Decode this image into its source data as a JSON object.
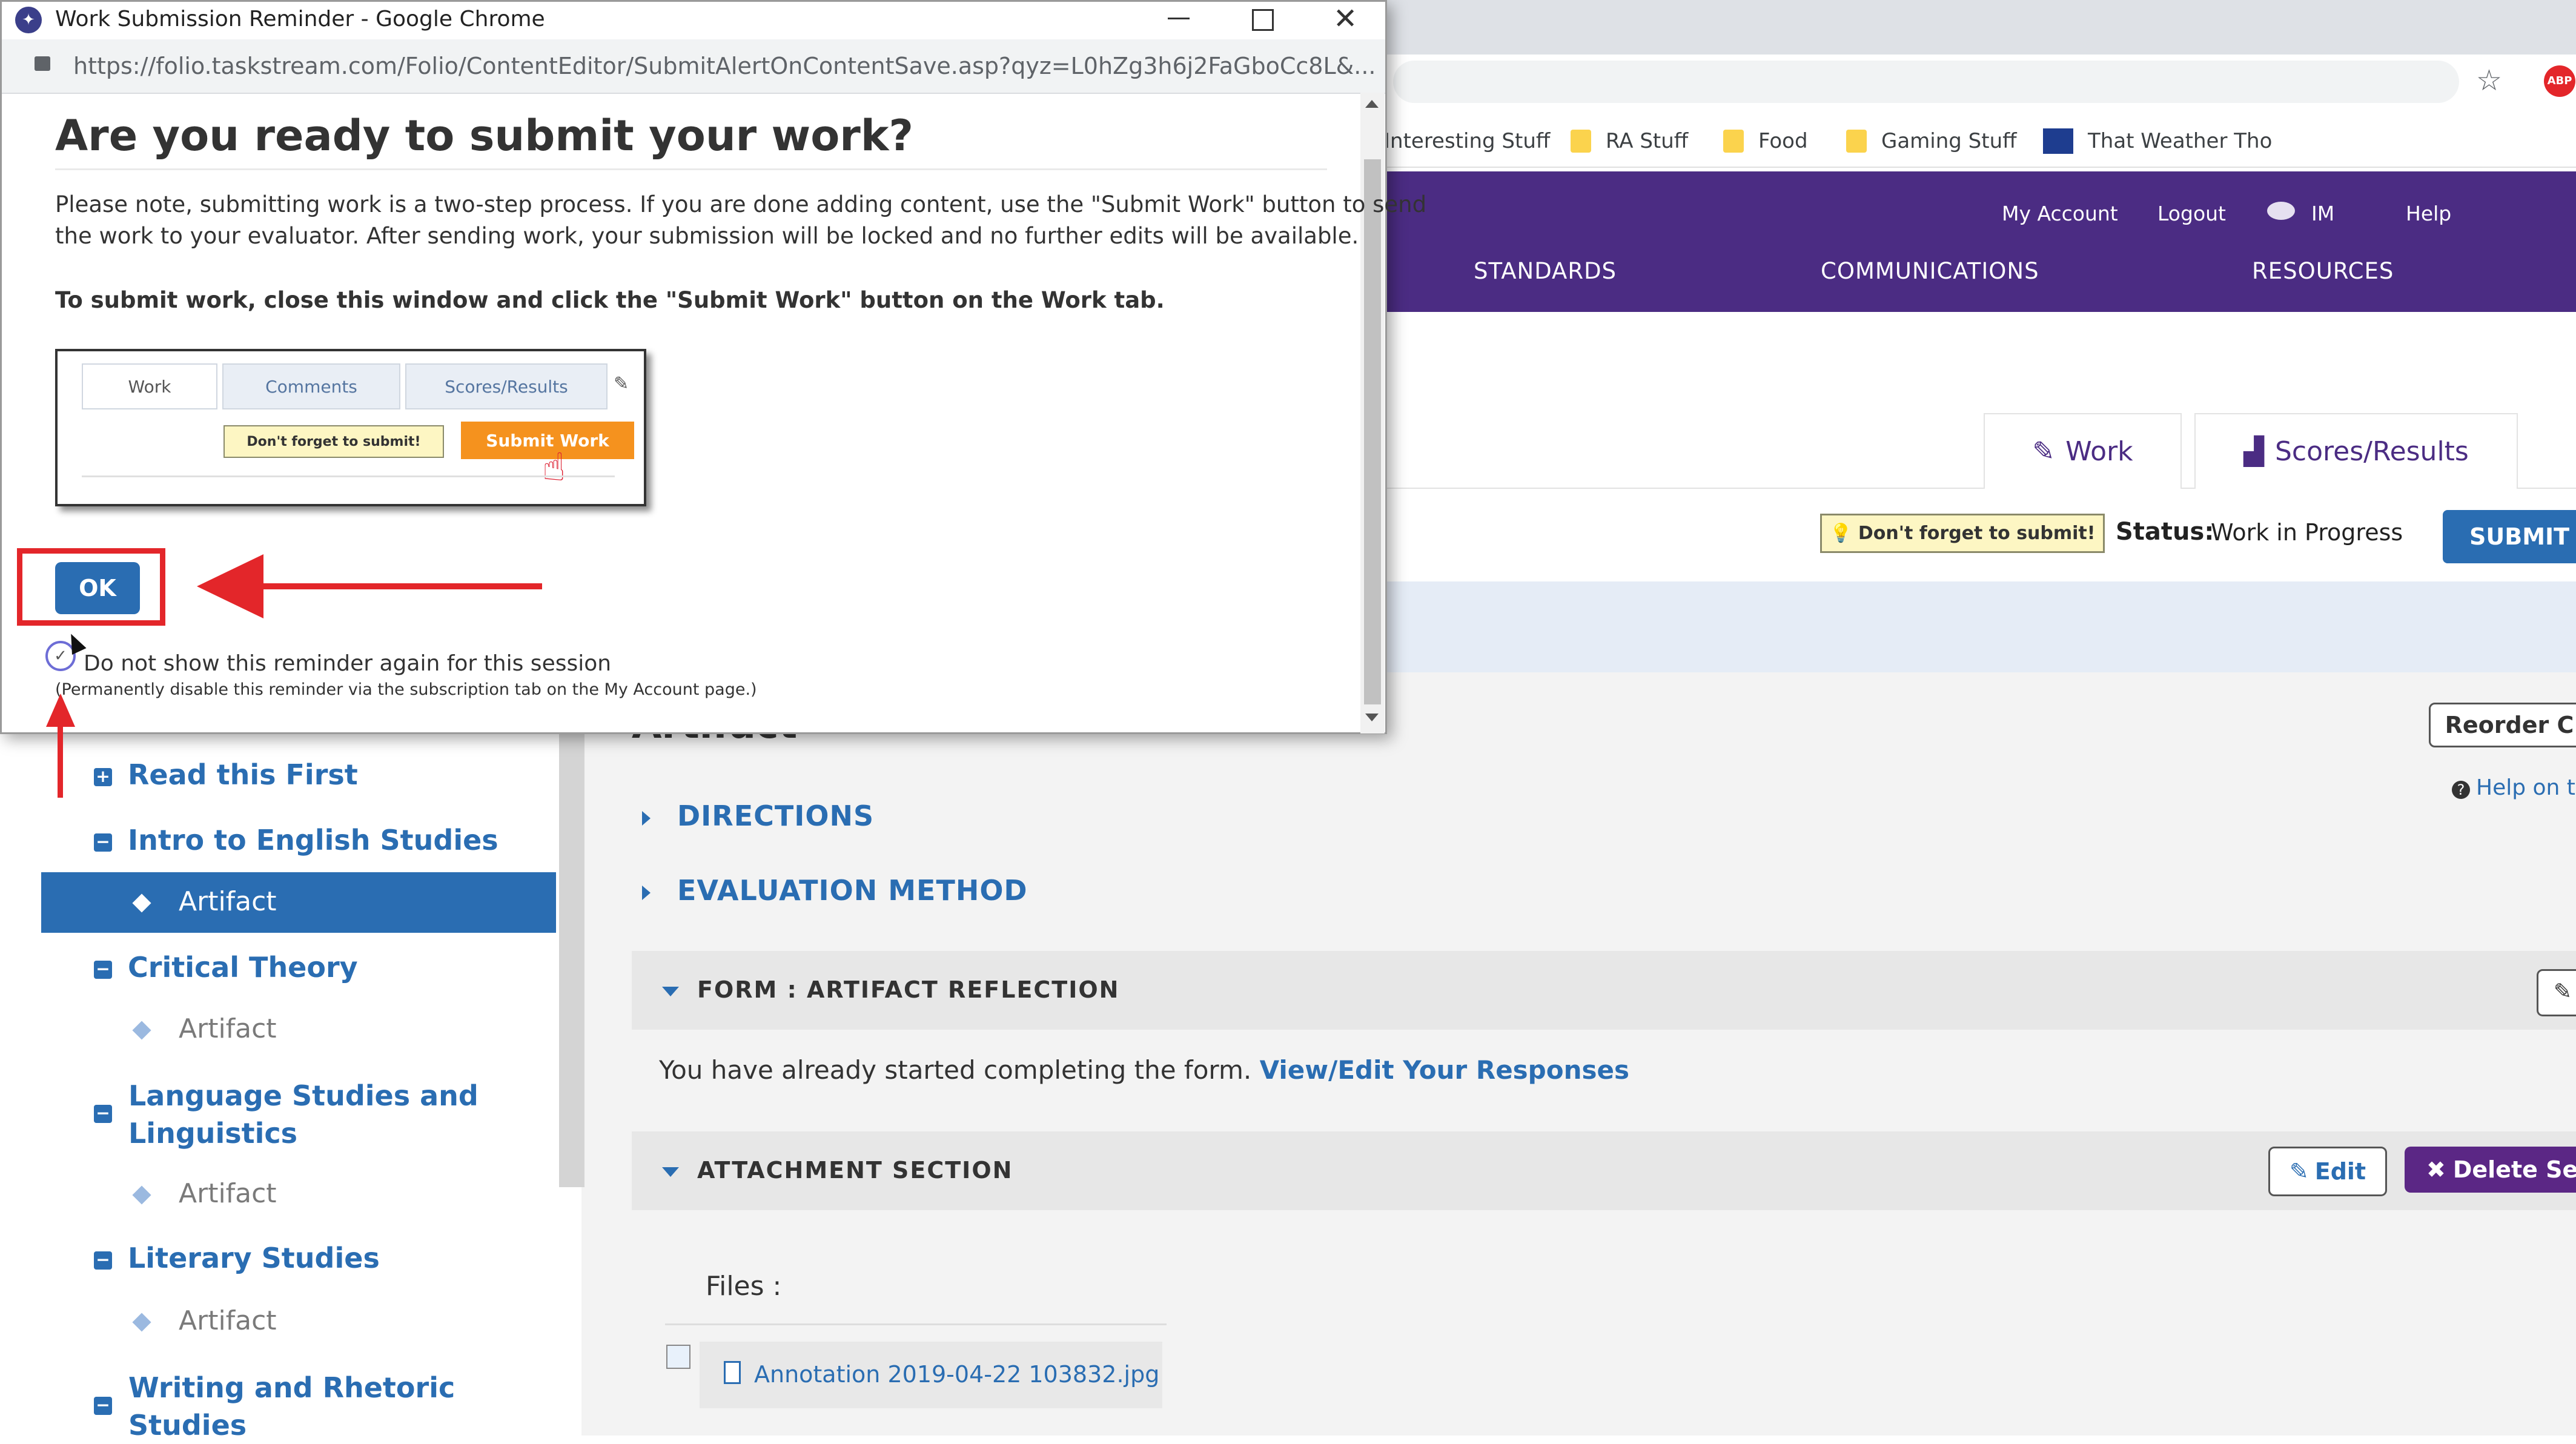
{
  "popup": {
    "window_title": "Work Submission Reminder - Google Chrome",
    "url": "https://folio.taskstream.com/Folio/ContentEditor/SubmitAlertOnContentSave.asp?qyz=L0hZg3h6j2FaGboCc8L&...",
    "heading": "Are you ready to submit your work?",
    "paragraph_line1": "Please note, submitting work is a two-step process. If you are done adding content, use the \"Submit Work\" button to send",
    "paragraph_line2": "the work to your evaluator. After sending work, your submission will be locked and no further edits will be available.",
    "instruction": "To submit work, close this window and click the \"Submit Work\" button on the Work tab.",
    "mini_tabs": [
      "Work",
      "Comments",
      "Scores/Results"
    ],
    "mini_reminder": "Don't forget to submit!",
    "mini_submit": "Submit Work",
    "ok_label": "OK",
    "checkbox_label": "Do not show this reminder again for this session",
    "checkbox_note": "(Permanently disable this reminder via the subscription tab on the My Account page.)"
  },
  "bookmarks": [
    "Interesting Stuff",
    "RA Stuff",
    "Food",
    "Gaming Stuff",
    "That Weather Tho"
  ],
  "header": {
    "top_links": [
      "My Account",
      "Logout",
      "IM",
      "Help"
    ],
    "nav": [
      "STANDARDS",
      "COMMUNICATIONS",
      "RESOURCES"
    ]
  },
  "work_tabs": [
    "Work",
    "Scores/Results"
  ],
  "status": {
    "reminder": "Don't forget to submit!",
    "label": "Status:",
    "value": "Work in Progress",
    "submit": "SUBMIT"
  },
  "reorder_button": "Reorder C",
  "help_link": "Help on t",
  "artifact_heading": "Artifact",
  "sidebar": [
    {
      "label": "Read this First",
      "icon": "plus"
    },
    {
      "label": "Intro to English Studies",
      "icon": "minus"
    },
    {
      "label": "Artifact",
      "sub": true,
      "active": true
    },
    {
      "label": "Critical Theory",
      "icon": "minus"
    },
    {
      "label": "Artifact",
      "sub": true
    },
    {
      "label": "Language Studies and",
      "label2": "Linguistics",
      "icon": "minus"
    },
    {
      "label": "Artifact",
      "sub": true
    },
    {
      "label": "Literary Studies",
      "icon": "minus"
    },
    {
      "label": "Artifact",
      "sub": true
    },
    {
      "label": "Writing and Rhetoric",
      "label2": "Studies",
      "icon": "minus"
    }
  ],
  "main": {
    "directions": "DIRECTIONS",
    "evaluation": "EVALUATION METHOD",
    "form_title": "FORM : ARTIFACT REFLECTION",
    "form_text": "You have already started completing the form.",
    "form_link": "View/Edit Your Responses",
    "attachment_title": "ATTACHMENT SECTION",
    "edit_button": "Edit",
    "delete_button": "Delete Sec",
    "files_label": "Files :",
    "file_name": "Annotation 2019-04-22 103832.jpg"
  }
}
